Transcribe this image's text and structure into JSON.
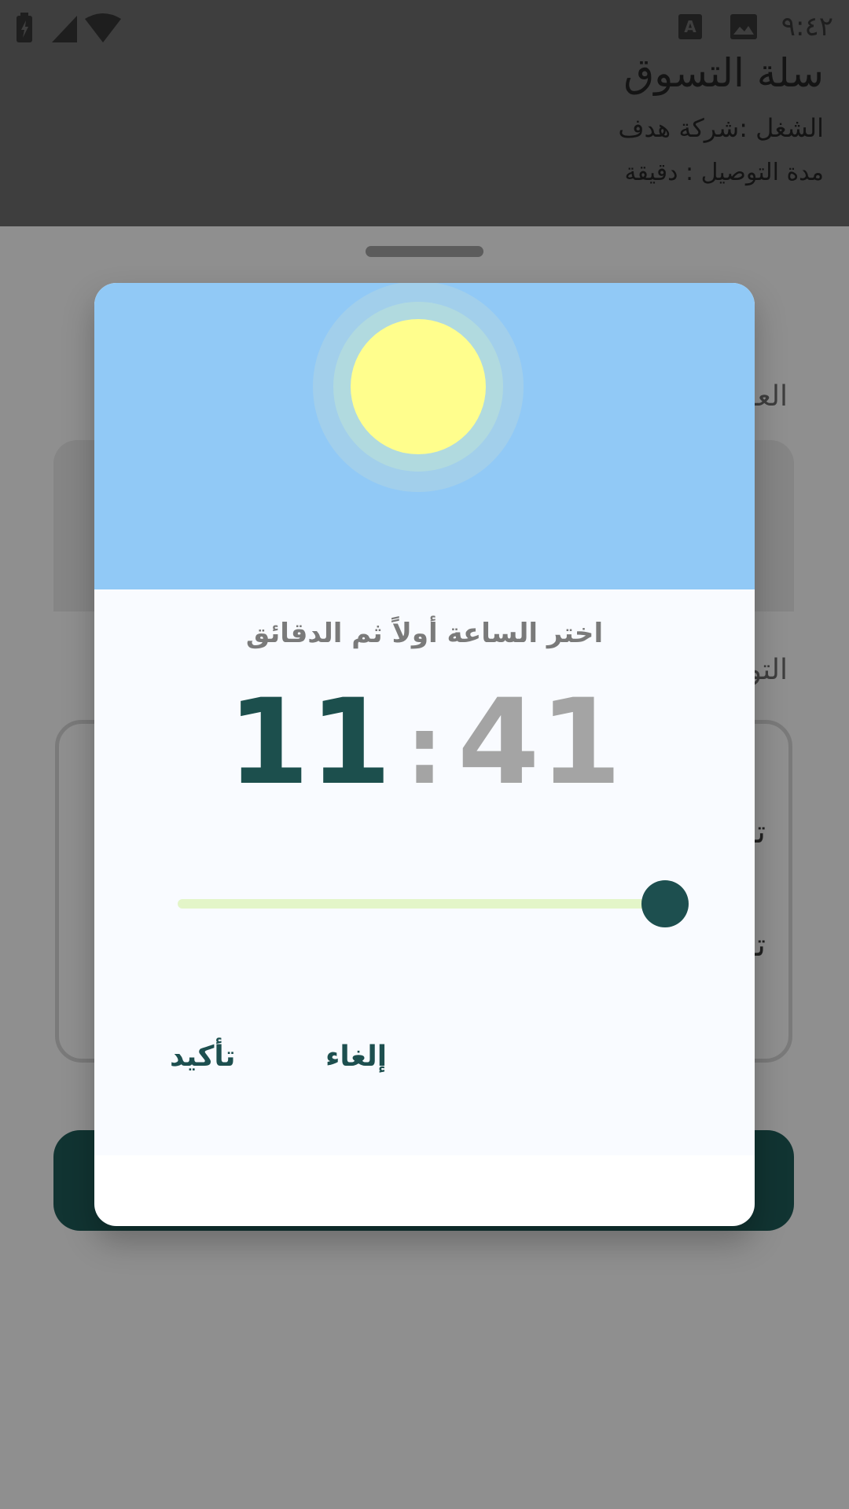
{
  "status_bar": {
    "time": "٩:٤٢",
    "icons": [
      "battery-icon",
      "signal-icon",
      "wifi-icon",
      "keyboard-icon",
      "image-icon"
    ]
  },
  "header": {
    "title": "سلة التسوق",
    "company_line": "الشغل   :شركة هدف",
    "delivery_line": "مدة التوصيل :   دقيقة"
  },
  "background": {
    "section_label_1": "العـ",
    "section_label_2": "التو",
    "row_1": "تـ",
    "row_2": "تـ"
  },
  "dialog": {
    "instruction": "اختر الساعة أولاً ثم الدقائق",
    "hour": "11",
    "separator": ":",
    "minute": "41",
    "slider_value_fraction": 1.0,
    "confirm_label": "تأكيد",
    "cancel_label": "إلغاء"
  },
  "colors": {
    "accent": "#1d4f4f",
    "sky": "#91c9f6",
    "sun": "#fffe8d",
    "slider_track": "#e3f5c8"
  }
}
